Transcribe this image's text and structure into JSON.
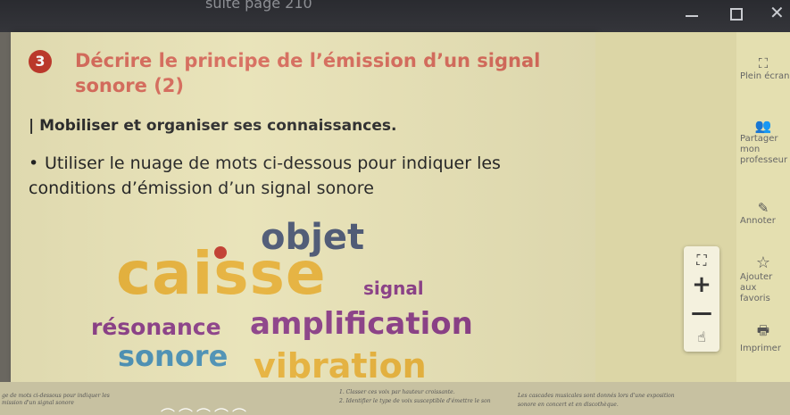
{
  "window": {
    "tab_text": "suite page 210",
    "min_glyph": "",
    "max_glyph": "",
    "close_glyph": "✕"
  },
  "question": {
    "number": "3",
    "title": "Décrire le principe de l’émission d’un signal sonore (2)",
    "skill": "| Mobiliser et organiser ses connaissances.",
    "bullet": "•",
    "instruction": "Utiliser le nuage de mots ci-dessous pour indiquer les conditions d’émission d’un signal sonore"
  },
  "word_cloud": {
    "words": [
      "objet",
      "caisse",
      "signal",
      "résonance",
      "amplification",
      "sonore",
      "vibration"
    ]
  },
  "zoom": {
    "fit_glyph": "⛶",
    "plus_glyph": "+",
    "minus_glyph": "—",
    "hand_glyph": "☝"
  },
  "sidebar": {
    "items": [
      {
        "icon": "⛶",
        "label": "Plein écran"
      },
      {
        "icon": "👥",
        "label": "Partager mon professeur"
      },
      {
        "icon": "✎",
        "label": "Annoter"
      },
      {
        "icon": "☆",
        "label": "Ajouter aux favoris"
      },
      {
        "icon": "🖶",
        "label": "Imprimer"
      }
    ]
  },
  "bottom_strip": {
    "left_text_1": "ge de mots ci-dessous pour indiquer les",
    "left_text_2": "mission d'un signal sonore",
    "mid_text_1": "1. Classer ces voix par hauteur croissante.",
    "mid_text_2": "2. Identifier le type de voix susceptible d'émettre le son",
    "right_text_1": "Les cascades musicales sont donnés lors d'une exposition",
    "right_text_2": "sonore en concert et en discothèque.",
    "arches": "⌒⌒⌒⌒⌒"
  }
}
